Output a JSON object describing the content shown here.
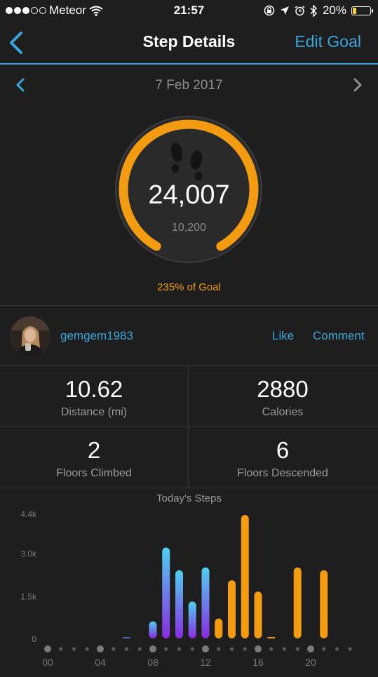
{
  "status": {
    "carrier": "Meteor",
    "signal_bars": 3,
    "time": "21:57",
    "battery": "20%"
  },
  "nav": {
    "title": "Step Details",
    "edit_goal": "Edit Goal"
  },
  "date": "7 Feb 2017",
  "summary": {
    "steps": "24,007",
    "goal": "10,200",
    "percent_of_goal": "235% of Goal"
  },
  "social": {
    "username": "gemgem1983",
    "like": "Like",
    "comment": "Comment"
  },
  "stats": [
    {
      "value": "10.62",
      "label": "Distance (mi)"
    },
    {
      "value": "2880",
      "label": "Calories"
    },
    {
      "value": "2",
      "label": "Floors Climbed"
    },
    {
      "value": "6",
      "label": "Floors Descended"
    }
  ],
  "colors": {
    "accent": "#3aa6dd",
    "goal_met": "#f39c12",
    "before_goal_top": "#4fd0f0",
    "before_goal_bottom": "#8a2be2",
    "background": "#1e1e1e"
  },
  "chart_data": {
    "type": "bar",
    "title": "Today's Steps",
    "y_ticks": [
      "4.4k",
      "3.0k",
      "1.5k",
      "0"
    ],
    "ylim": [
      0,
      4400
    ],
    "x_ticks": [
      "00",
      "04",
      "08",
      "12",
      "16",
      "20"
    ],
    "x_tick_hours": [
      0,
      4,
      8,
      12,
      16,
      20
    ],
    "bars": [
      {
        "hour": 6,
        "value": 20,
        "color": "purple"
      },
      {
        "hour": 8,
        "value": 600,
        "color": "purple"
      },
      {
        "hour": 9,
        "value": 3200,
        "color": "purple"
      },
      {
        "hour": 10,
        "value": 2400,
        "color": "purple"
      },
      {
        "hour": 11,
        "value": 1300,
        "color": "purple"
      },
      {
        "hour": 12,
        "value": 2500,
        "color": "purple"
      },
      {
        "hour": 13,
        "value": 700,
        "color": "orange"
      },
      {
        "hour": 14,
        "value": 2050,
        "color": "orange"
      },
      {
        "hour": 15,
        "value": 4350,
        "color": "orange"
      },
      {
        "hour": 16,
        "value": 1650,
        "color": "orange"
      },
      {
        "hour": 17,
        "value": 50,
        "color": "orange"
      },
      {
        "hour": 19,
        "value": 2500,
        "color": "orange"
      },
      {
        "hour": 21,
        "value": 2400,
        "color": "orange"
      }
    ]
  }
}
